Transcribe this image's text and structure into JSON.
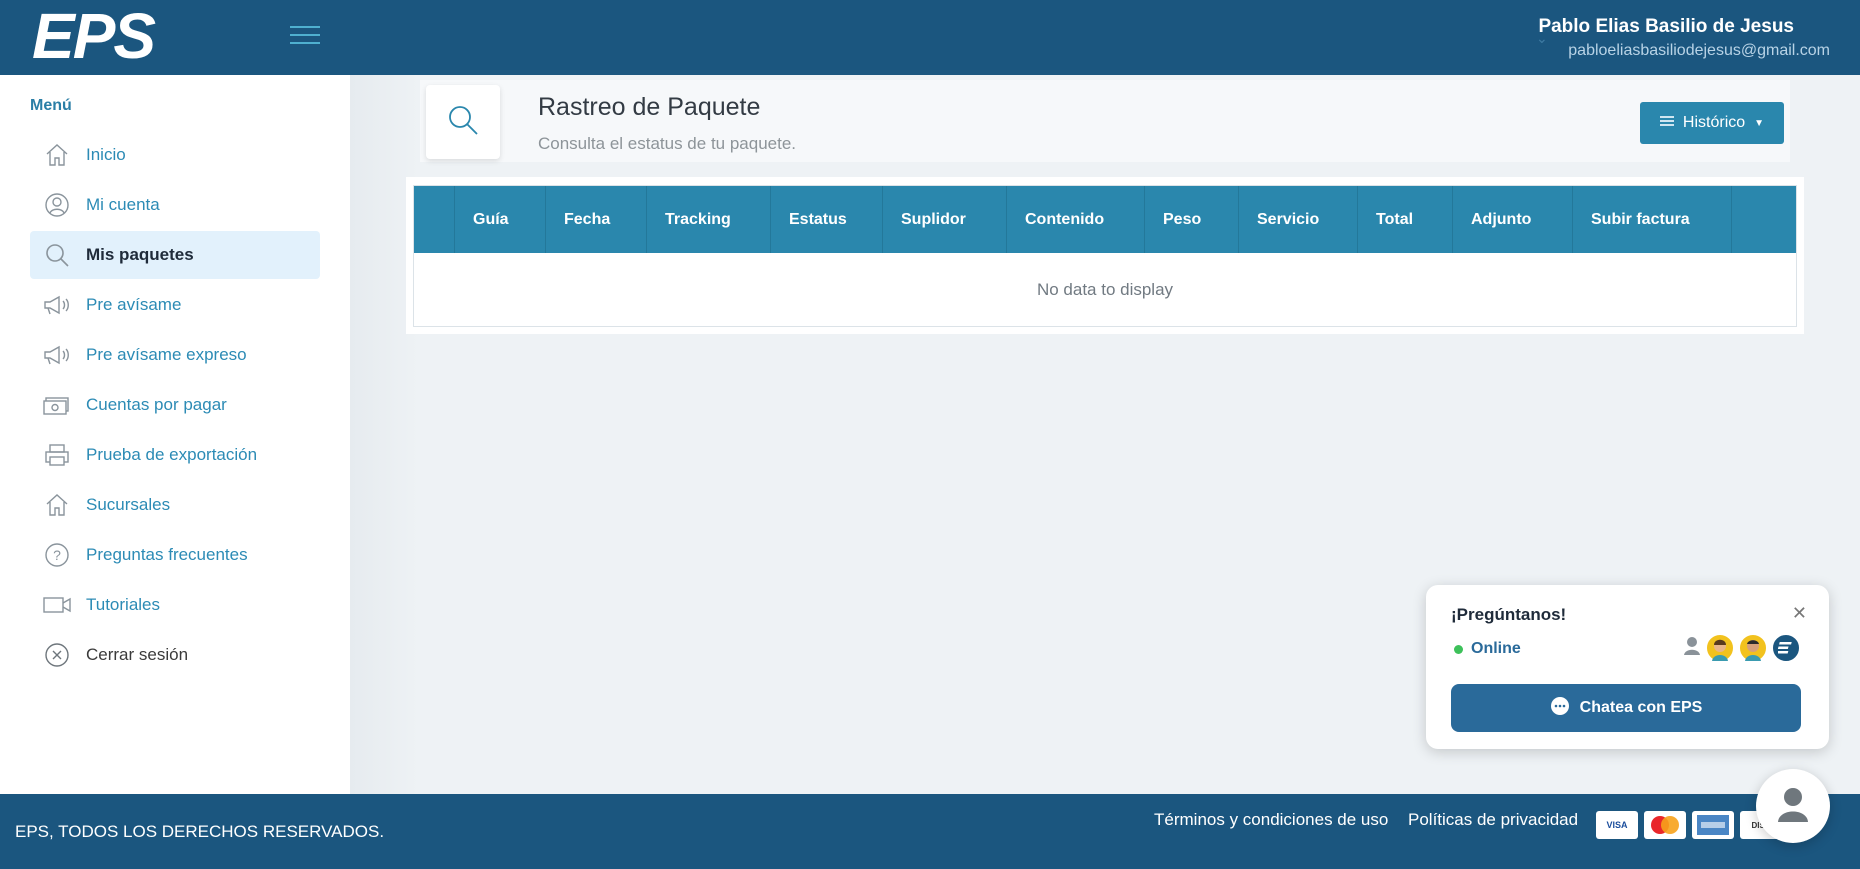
{
  "header": {
    "logo_text": "EPS",
    "user_name": "Pablo Elias Basilio de Jesus",
    "user_email": "pabloeliasbasiliodejesus@gmail.com"
  },
  "sidebar": {
    "title": "Menú",
    "items": [
      {
        "label": "Inicio",
        "icon": "home-icon"
      },
      {
        "label": "Mi cuenta",
        "icon": "user-icon"
      },
      {
        "label": "Mis paquetes",
        "icon": "search-icon",
        "active": true
      },
      {
        "label": "Pre avísame",
        "icon": "megaphone-icon"
      },
      {
        "label": "Pre avísame expreso",
        "icon": "megaphone-icon"
      },
      {
        "label": "Cuentas por pagar",
        "icon": "money-icon"
      },
      {
        "label": "Prueba de exportación",
        "icon": "printer-icon"
      },
      {
        "label": "Sucursales",
        "icon": "home-icon"
      },
      {
        "label": "Preguntas frecuentes",
        "icon": "question-icon"
      },
      {
        "label": "Tutoriales",
        "icon": "video-icon"
      },
      {
        "label": "Cerrar sesión",
        "icon": "close-circle-icon"
      }
    ]
  },
  "page": {
    "title": "Rastreo de Paquete",
    "subtitle": "Consulta el estatus de tu paquete.",
    "history_button": "Histórico"
  },
  "table": {
    "columns": [
      "",
      "Guía",
      "Fecha",
      "Tracking",
      "Estatus",
      "Suplidor",
      "Contenido",
      "Peso",
      "Servicio",
      "Total",
      "Adjunto",
      "Subir factura"
    ],
    "empty_text": "No data to display"
  },
  "footer": {
    "copyright": "EPS, TODOS LOS DERECHOS RESERVADOS.",
    "terms": "Términos y condiciones de uso",
    "privacy": "Políticas de privacidad",
    "cards": [
      "VISA",
      "MasterCard",
      "AMEX",
      "DISC"
    ]
  },
  "chat": {
    "title": "¡Pregúntanos!",
    "status": "Online",
    "button": "Chatea con EPS"
  },
  "colors": {
    "header_bg": "#1b567f",
    "accent": "#2a87ad",
    "active_bg": "#e2f1fc",
    "online": "#3dc15a"
  }
}
